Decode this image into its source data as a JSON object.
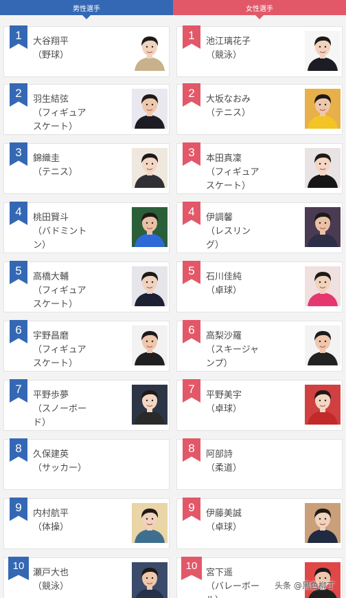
{
  "header": {
    "male_tab": "男性選手",
    "female_tab": "女性選手"
  },
  "male": [
    {
      "rank": "1",
      "name": "大谷翔平\n（野球）"
    },
    {
      "rank": "2",
      "name": "羽生結弦\n（フィギュア\nスケート）"
    },
    {
      "rank": "3",
      "name": "錦織圭\n（テニス）"
    },
    {
      "rank": "4",
      "name": "桃田賢斗\n（バドミント\nン）"
    },
    {
      "rank": "5",
      "name": "高橋大輔\n（フィギュア\nスケート）"
    },
    {
      "rank": "6",
      "name": "宇野昌磨\n（フィギュア\nスケート）"
    },
    {
      "rank": "7",
      "name": "平野歩夢\n（スノーボー\nド）"
    },
    {
      "rank": "8",
      "name": "久保建英\n（サッカー）"
    },
    {
      "rank": "9",
      "name": "内村航平\n（体操）"
    },
    {
      "rank": "10",
      "name": "瀬戸大也\n（競泳）"
    }
  ],
  "female": [
    {
      "rank": "1",
      "name": "池江璃花子\n（競泳）"
    },
    {
      "rank": "2",
      "name": "大坂なおみ\n（テニス）"
    },
    {
      "rank": "3",
      "name": "本田真凜\n（フィギュア\nスケート）"
    },
    {
      "rank": "4",
      "name": "伊調馨\n（レスリン\nグ）"
    },
    {
      "rank": "5",
      "name": "石川佳純\n（卓球）"
    },
    {
      "rank": "6",
      "name": "高梨沙羅\n（スキージャ\nンプ）"
    },
    {
      "rank": "7",
      "name": "平野美宇\n（卓球）"
    },
    {
      "rank": "8",
      "name": "阿部詩\n（柔道）"
    },
    {
      "rank": "9",
      "name": "伊藤美誠\n（卓球）"
    },
    {
      "rank": "10",
      "name": "宮下遥\n（バレーボー\nル）"
    }
  ],
  "watermark": "头条 @黑色柳丁",
  "colors": {
    "male_accent": "#3468b4",
    "female_accent": "#e25868"
  }
}
